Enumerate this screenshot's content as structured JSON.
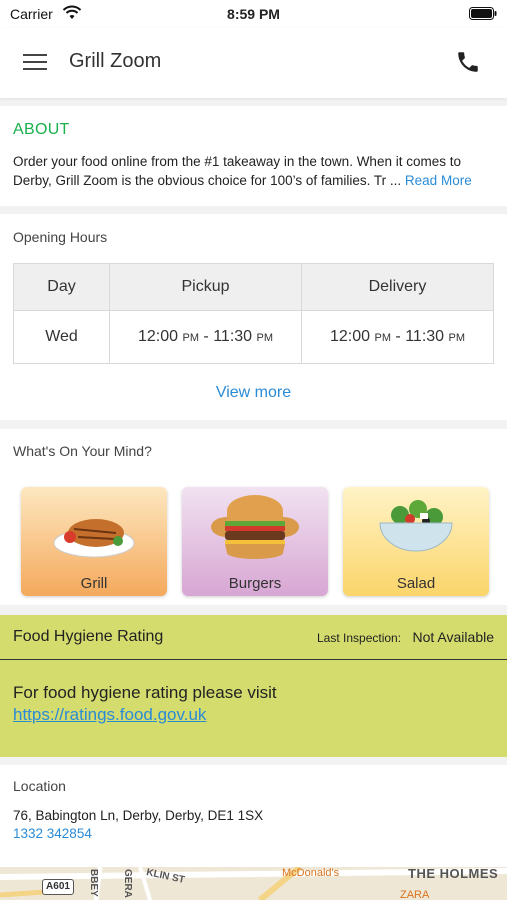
{
  "status_bar": {
    "carrier": "Carrier",
    "time": "8:59 PM"
  },
  "nav": {
    "title": "Grill Zoom"
  },
  "about": {
    "heading": "ABOUT",
    "text": "Order your food online from the #1 takeaway in the town. When it comes to Derby, Grill Zoom is the obvious choice for 100’s of families. Tr ...",
    "read_more": "Read More"
  },
  "hours": {
    "label": "Opening Hours",
    "columns": [
      "Day",
      "Pickup",
      "Delivery"
    ],
    "row": {
      "day": "Wed",
      "pickup_start": "12:00",
      "pickup_start_suffix": "PM",
      "pickup_sep": " - ",
      "pickup_end": "11:30",
      "pickup_end_suffix": "PM",
      "delivery_start": "12:00",
      "delivery_start_suffix": "PM",
      "delivery_sep": " - ",
      "delivery_end": "11:30",
      "delivery_end_suffix": "PM"
    },
    "view_more": "View more"
  },
  "mind": {
    "label": "What's On Your Mind?",
    "categories": [
      {
        "name": "Grill",
        "icon": "grill-chicken-image"
      },
      {
        "name": "Burgers",
        "icon": "burgers-image"
      },
      {
        "name": "Salad",
        "icon": "salad-bowl-image"
      }
    ]
  },
  "hygiene": {
    "title": "Food Hygiene Rating",
    "inspection_label": "Last Inspection:",
    "inspection_value": "Not Available",
    "message": "For food hygiene rating please visit",
    "link": "https://ratings.food.gov.uk",
    "background_color": "#d4dc6e"
  },
  "location": {
    "label": "Location",
    "address": "76, Babington Ln, Derby, Derby, DE1 1SX",
    "phone": "1332 342854"
  },
  "map": {
    "shield": "A601",
    "road_1": "BBEY",
    "road_2": "GERA",
    "road_3": "KLIN ST",
    "poi": "McDonald's",
    "area": "THE HOLMES",
    "poi_2": "ZARA"
  },
  "colors": {
    "accent_green": "#1ab04c",
    "link_blue": "#2a8bd6"
  }
}
